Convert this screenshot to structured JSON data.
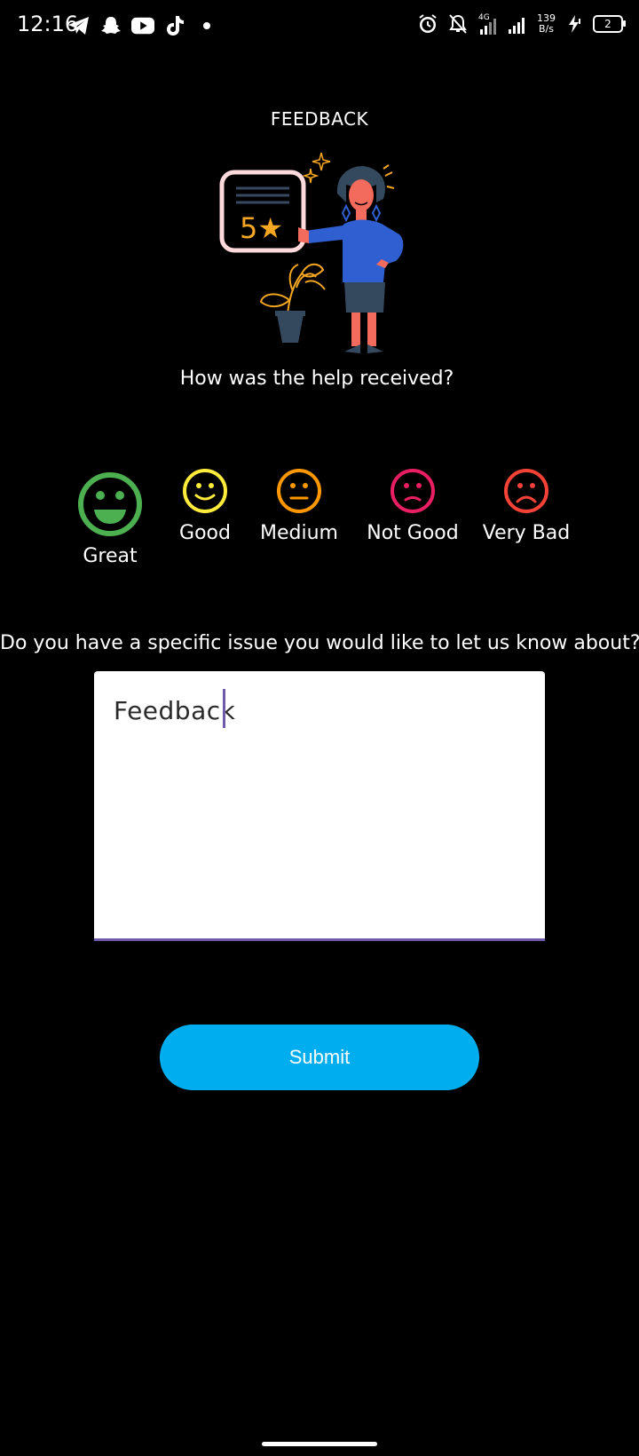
{
  "status_bar": {
    "time": "12:16",
    "left_icons": [
      "telegram-icon",
      "snapchat-icon",
      "youtube-icon",
      "tiktok-icon",
      "notification-dot-icon"
    ],
    "right_icons": [
      "alarm-icon",
      "bell-muted-icon",
      "signal-4g-icon",
      "signal-icon",
      "charging-icon"
    ],
    "net_speed_value": "139",
    "net_speed_unit": "B/s",
    "network_type": "4G",
    "battery_level": "2"
  },
  "header": {
    "title": "FEEDBACK"
  },
  "illustration": {
    "card_text": "5★"
  },
  "question": "How was the help received?",
  "ratings": [
    {
      "label": "Great",
      "color": "#4caf50",
      "mood": "grin",
      "selected": true
    },
    {
      "label": "Good",
      "color": "#ffeb3b",
      "mood": "smile",
      "selected": false
    },
    {
      "label": "Medium",
      "color": "#ff9800",
      "mood": "neutral",
      "selected": false
    },
    {
      "label": "Not Good",
      "color": "#e91e63",
      "mood": "slight-frown",
      "selected": false
    },
    {
      "label": "Very Bad",
      "color": "#f44336",
      "mood": "frown",
      "selected": false
    }
  ],
  "issue_question": "Do you have a specific issue you would like to let us know about?",
  "feedback_input": {
    "value": "Feedback"
  },
  "submit_label": "Submit",
  "colors": {
    "background": "#000000",
    "accent": "#00aeef",
    "input_underline": "#6e5aa8"
  }
}
